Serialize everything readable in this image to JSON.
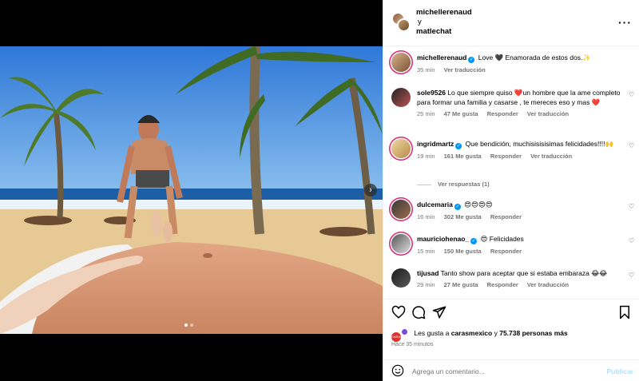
{
  "header": {
    "user1": "michellerenaud",
    "connector": "y",
    "user2": "matlechat",
    "more_icon": "more-horizontal-icon"
  },
  "media": {
    "carousel_next_icon": "chevron-right-icon",
    "colors": {
      "sky": "#3a86e0",
      "sea": "#1f6fb8",
      "sand": "#e9cf9c",
      "skin": "#d79a78"
    }
  },
  "caption": {
    "user": "michellerenaud",
    "text": "Love 🖤 Enamorada de estos dos.✨",
    "time": "35 min",
    "translate": "Ver traducción"
  },
  "comments": [
    {
      "user": "sole9526",
      "verified": false,
      "text": "Lo que siempre quiso ❤️un hombre que la ame completo para formar una familia y casarse , te mereces eso y mas ❤️",
      "time": "25 min",
      "likes": "47 Me gusta",
      "reply": "Responder",
      "translate": "Ver traducción"
    },
    {
      "user": "ingridmartz",
      "verified": true,
      "text": "Que bendición, muchisisisisimas felicidades!!!!🙌",
      "time": "19 min",
      "likes": "161 Me gusta",
      "reply": "Responder",
      "translate": "Ver traducción"
    },
    {
      "user": "dulcemaria",
      "verified": true,
      "text": "😍😍😍😍",
      "time": "16 min",
      "likes": "302 Me gusta",
      "reply": "Responder"
    },
    {
      "user": "mauriciohenao_",
      "verified": true,
      "text": "😍 Felicidades",
      "time": "15 min",
      "likes": "150 Me gusta",
      "reply": "Responder"
    },
    {
      "user": "tijusad",
      "verified": false,
      "text": "Tanto show para aceptar que si estaba embaraza 😂😂",
      "time": "29 min",
      "likes": "27 Me gusta",
      "reply": "Responder",
      "translate": "Ver traducción"
    }
  ],
  "view_replies": "Ver respuestas (1)",
  "actions": {
    "like_icon": "heart-icon",
    "comment_icon": "comment-icon",
    "share_icon": "send-icon",
    "save_icon": "bookmark-icon"
  },
  "likes": {
    "prefix": "Les gusta a",
    "user": "carasmexico",
    "connector": "y",
    "others": "75.738 personas más",
    "liker_badge": "CARAS"
  },
  "posted": "Hace 35 minutos",
  "composer": {
    "placeholder": "Agrega un comentario...",
    "publish": "Publicar",
    "emoji_icon": "smiley-icon"
  }
}
